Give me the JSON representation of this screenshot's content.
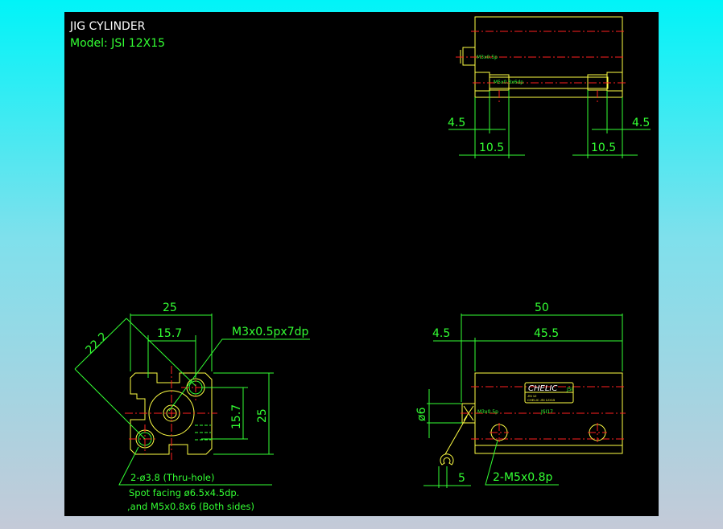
{
  "title": "JIG CYLINDER",
  "model": "Model: JSI 12X15",
  "top_view": {
    "port_label": "M3x0.5p",
    "tap_label": "M5x0.8x6dp",
    "dim_left_a": "4.5",
    "dim_left_b": "10.5",
    "dim_right_a": "4.5",
    "dim_right_b": "10.5"
  },
  "end_view": {
    "width": "25",
    "diag": "22.2",
    "pitch_h": "15.7",
    "thread": "M3x0.5px7dp",
    "pitch_v": "15.7",
    "height": "25",
    "hole_note": "2-ø3.8 (Thru-hole)",
    "spot_note": "Spot facing ø6.5x4.5dp.",
    "and_note": ",and M5x0.8x6 (Both sides)"
  },
  "side_view": {
    "length": "50",
    "rod_ext": "4.5",
    "body": "45.5",
    "rod_dia": "ø6",
    "wrench": "5",
    "mount": "2-M5x0.8p",
    "brand": "CHELIC",
    "brand_sub": "JSI",
    "port_label": "M3x0.5p",
    "plate_line1": "JSI 12",
    "plate_line2": "CHELIC JSI 12X15",
    "model_mark": "JSI17"
  }
}
